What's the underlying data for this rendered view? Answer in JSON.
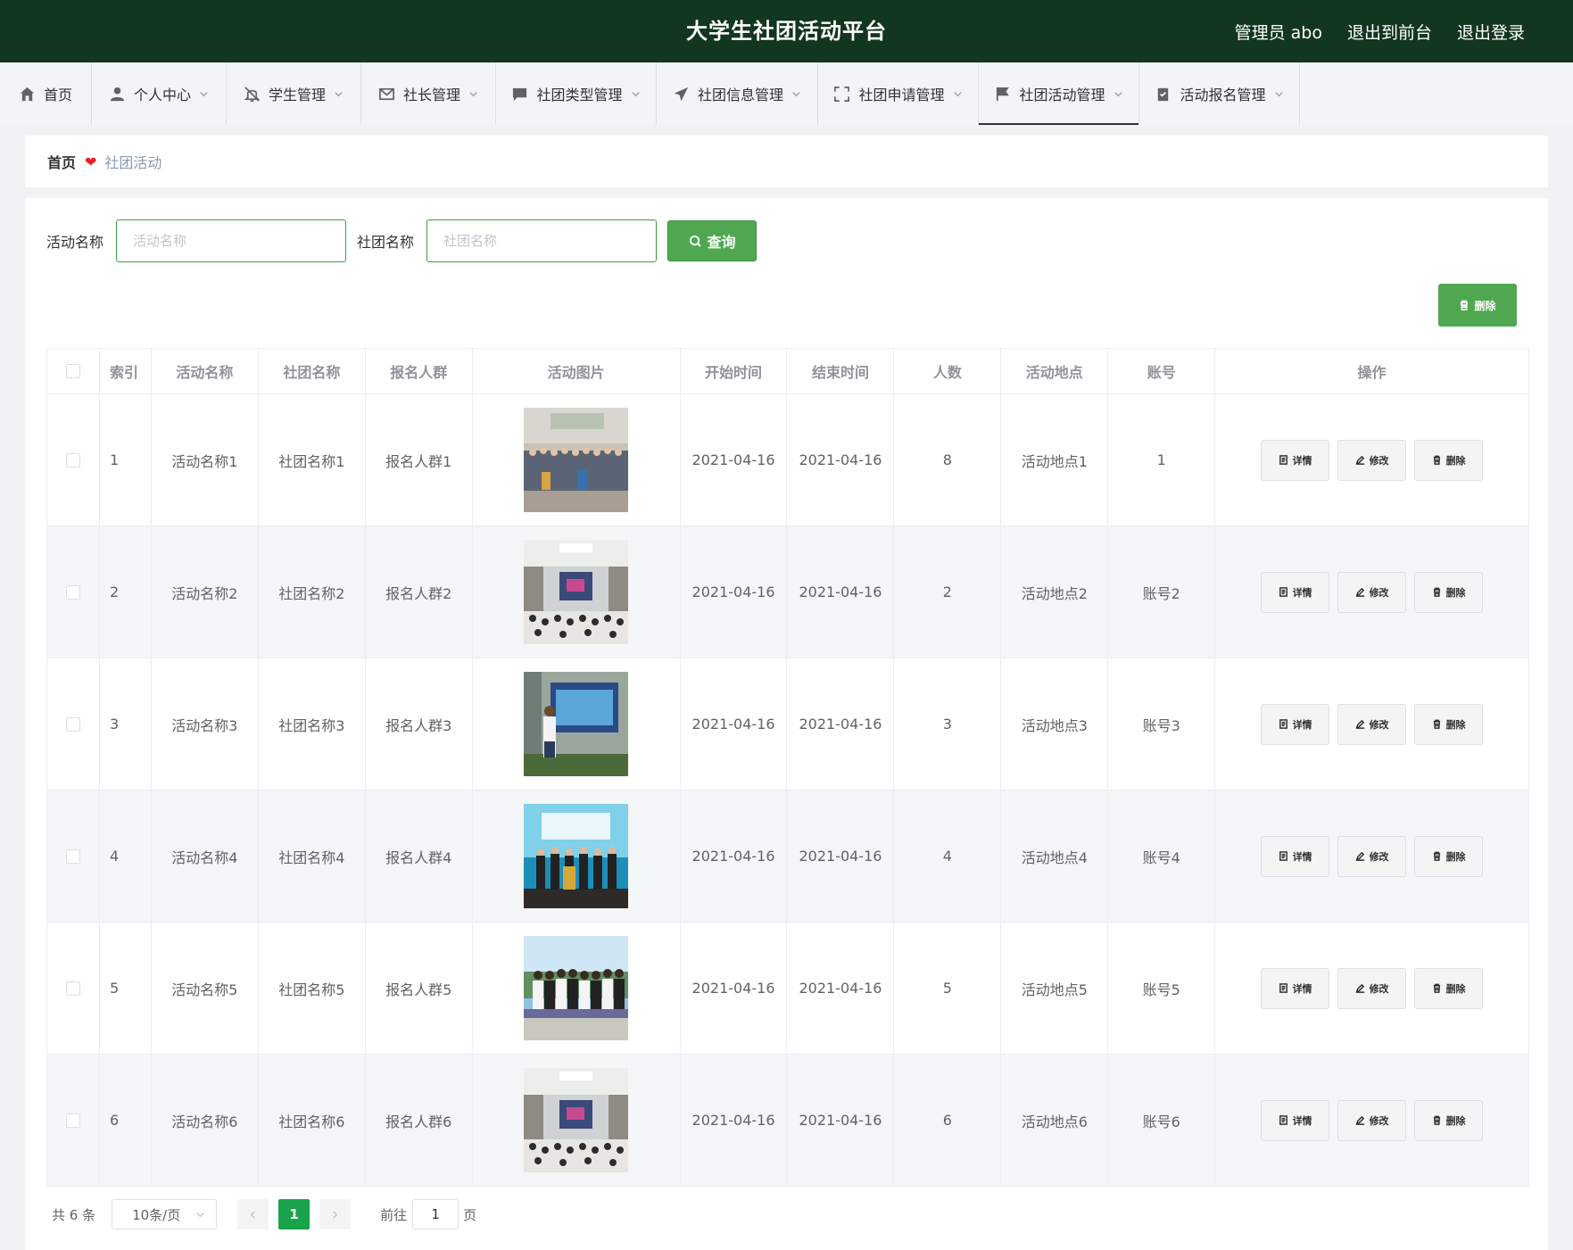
{
  "header": {
    "title": "大学生社团活动平台",
    "user": "管理员 abo",
    "back_front": "退出到前台",
    "logout": "退出登录",
    "bg_color": "#12361f"
  },
  "nav": [
    {
      "label": "首页",
      "icon": "home-icon"
    },
    {
      "label": "个人中心",
      "icon": "user-icon"
    },
    {
      "label": "学生管理",
      "icon": "bell-icon"
    },
    {
      "label": "社长管理",
      "icon": "mail-icon"
    },
    {
      "label": "社团类型管理",
      "icon": "chat-icon"
    },
    {
      "label": "社团信息管理",
      "icon": "send-icon"
    },
    {
      "label": "社团申请管理",
      "icon": "fullscreen-icon"
    },
    {
      "label": "社团活动管理",
      "icon": "flag-icon"
    },
    {
      "label": "活动报名管理",
      "icon": "clipboard-icon"
    }
  ],
  "breadcrumb": {
    "home": "首页",
    "current": "社团活动"
  },
  "search": {
    "activity_label": "活动名称",
    "activity_placeholder": "活动名称",
    "club_label": "社团名称",
    "club_placeholder": "社团名称",
    "query_button": "查询"
  },
  "delete_button": "删除",
  "table": {
    "columns": [
      "索引",
      "活动名称",
      "社团名称",
      "报名人群",
      "活动图片",
      "开始时间",
      "结束时间",
      "人数",
      "活动地点",
      "账号",
      "操作"
    ],
    "rows": [
      {
        "index": "1",
        "name": "活动名称1",
        "club": "社团名称1",
        "crowd": "报名人群1",
        "start": "2021-04-16",
        "end": "2021-04-16",
        "count": "8",
        "place": "活动地点1",
        "account": "1",
        "image": "group-photo-classroom"
      },
      {
        "index": "2",
        "name": "活动名称2",
        "club": "社团名称2",
        "crowd": "报名人群2",
        "start": "2021-04-16",
        "end": "2021-04-16",
        "count": "2",
        "place": "活动地点2",
        "account": "账号2",
        "image": "hall-audience"
      },
      {
        "index": "3",
        "name": "活动名称3",
        "club": "社团名称3",
        "crowd": "报名人群3",
        "start": "2021-04-16",
        "end": "2021-04-16",
        "count": "3",
        "place": "活动地点3",
        "account": "账号3",
        "image": "presenter-screen"
      },
      {
        "index": "4",
        "name": "活动名称4",
        "club": "社团名称4",
        "crowd": "报名人群4",
        "start": "2021-04-16",
        "end": "2021-04-16",
        "count": "4",
        "place": "活动地点4",
        "account": "账号4",
        "image": "stage-group"
      },
      {
        "index": "5",
        "name": "活动名称5",
        "club": "社团名称5",
        "crowd": "报名人群5",
        "start": "2021-04-16",
        "end": "2021-04-16",
        "count": "5",
        "place": "活动地点5",
        "account": "账号5",
        "image": "outdoor-group"
      },
      {
        "index": "6",
        "name": "活动名称6",
        "club": "社团名称6",
        "crowd": "报名人群6",
        "start": "2021-04-16",
        "end": "2021-04-16",
        "count": "6",
        "place": "活动地点6",
        "account": "账号6",
        "image": "hall-audience"
      }
    ],
    "ops": {
      "detail": "详情",
      "edit": "修改",
      "delete": "删除"
    }
  },
  "pagination": {
    "total": "共 6 条",
    "page_size": "10条/页",
    "current_page": "1",
    "goto_label": "前往",
    "goto_value": "1",
    "page_suffix": "页"
  },
  "colors": {
    "accent": "#4fa84f",
    "page_active": "#1aa34a",
    "heart": "#e62020"
  }
}
